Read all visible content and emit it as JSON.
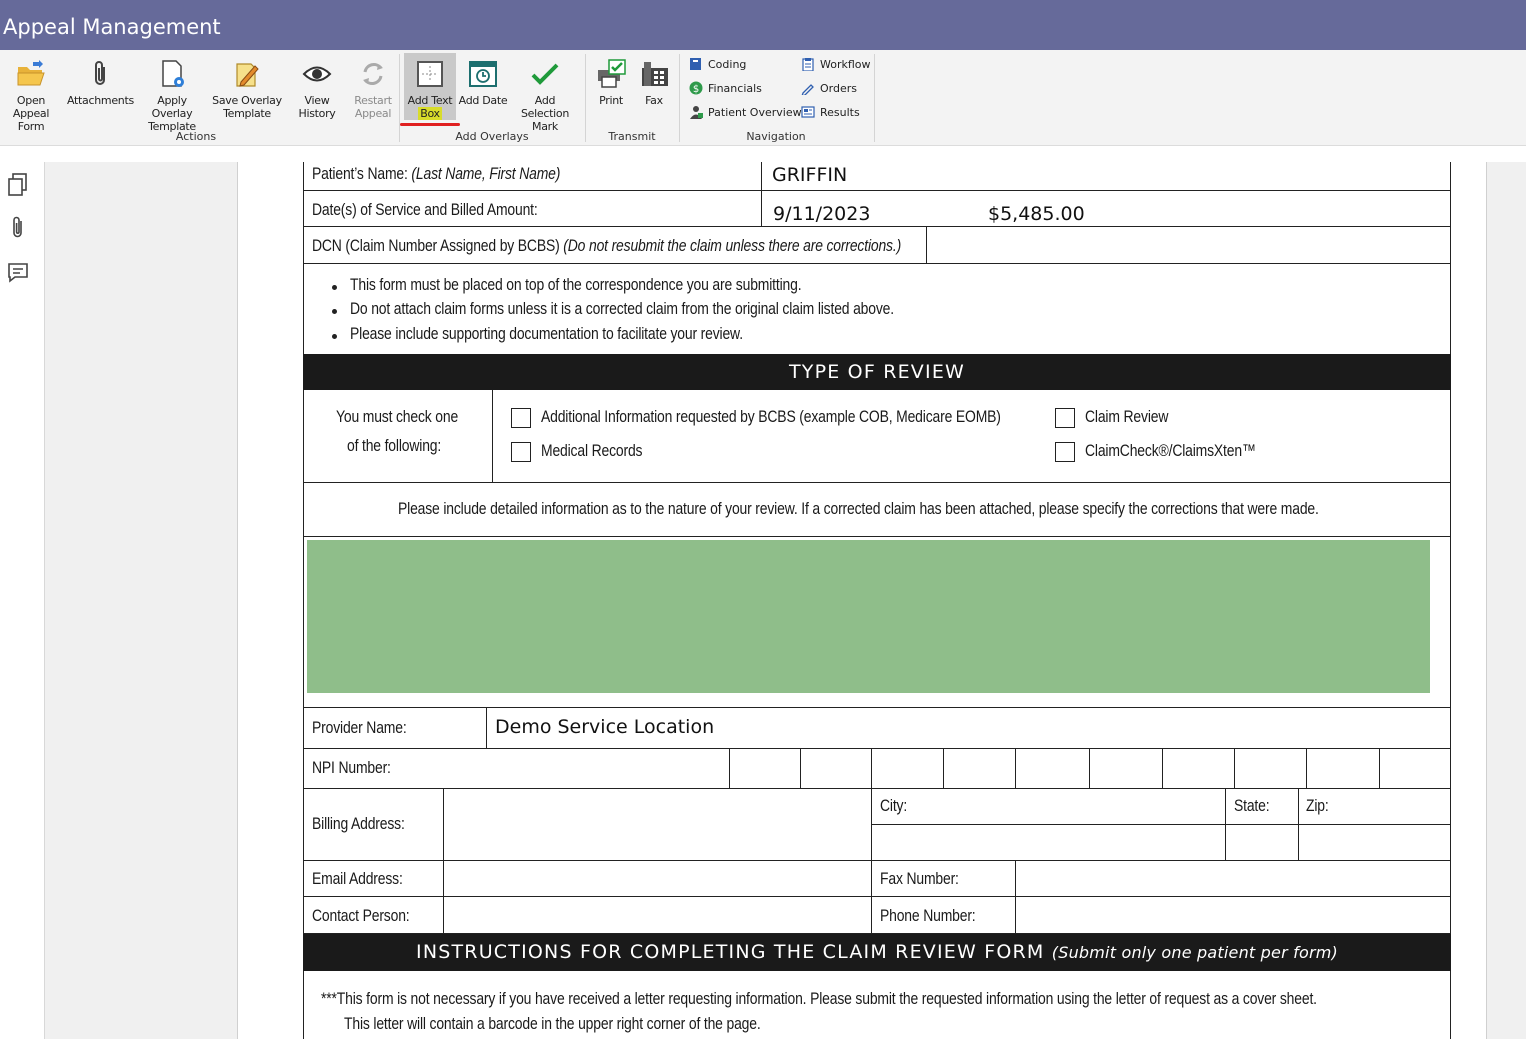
{
  "window": {
    "title": "Appeal Management"
  },
  "ribbon": {
    "actions": {
      "group_label": "Actions",
      "open_appeal_form": "Open Appeal\nForm",
      "attachments": "Attachments",
      "apply_overlay_template": "Apply Overlay\nTemplate",
      "save_overlay_template": "Save Overlay\nTemplate",
      "view_history": "View History",
      "restart_appeal": "Restart\nAppeal"
    },
    "add_overlays": {
      "group_label": "Add Overlays",
      "add_text_box_line1": "Add Text",
      "add_text_box_line2": "Box",
      "add_date": "Add Date",
      "add_selection_mark": "Add Selection\nMark"
    },
    "transmit": {
      "group_label": "Transmit",
      "print": "Print",
      "fax": "Fax"
    },
    "navigation": {
      "group_label": "Navigation",
      "coding": "Coding",
      "financials": "Financials",
      "patient_overview": "Patient Overview",
      "workflow": "Workflow",
      "orders": "Orders",
      "results": "Results"
    }
  },
  "form": {
    "patient_name_label": "Patient’s Name:",
    "patient_name_hint": "(Last Name, First Name)",
    "patient_name_value": "GRIFFIN",
    "dos_label": "Date(s) of Service and Billed Amount:",
    "dos_value": "9/11/2023",
    "billed_amount": "$5,485.00",
    "dcn_label": "DCN (Claim Number Assigned by BCBS)",
    "dcn_hint": "(Do not resubmit the claim unless there are corrections.)",
    "bullets": [
      "This form must be placed on top of the correspondence you are submitting.",
      "Do not attach claim forms unless it is a corrected claim from the original claim listed above.",
      "Please include supporting documentation to facilitate your review."
    ],
    "type_of_review_header": "TYPE OF REVIEW",
    "must_check_line1": "You must check one",
    "must_check_line2": "of the following:",
    "options": {
      "additional_info": "Additional Information requested by BCBS (example COB, Medicare EOMB)",
      "medical_records": "Medical Records",
      "claim_review": "Claim Review",
      "claimcheck": "ClaimCheck®/ClaimsXten™"
    },
    "detail_instructions": "Please include detailed information as to the nature of your review. If a corrected claim has been attached, please specify the corrections that were made.",
    "provider_name_label": "Provider Name:",
    "provider_name_value": "Demo Service Location",
    "npi_label": "NPI Number:",
    "billing_address_label": "Billing Address:",
    "city_label": "City:",
    "state_label": "State:",
    "zip_label": "Zip:",
    "email_label": "Email Address:",
    "fax_number_label": "Fax Number:",
    "contact_person_label": "Contact Person:",
    "phone_number_label": "Phone Number:",
    "instructions_header": "INSTRUCTIONS FOR COMPLETING THE CLAIM REVIEW FORM",
    "instructions_header_note": "(Submit only one patient per form)",
    "note_line1": "***This form is not necessary if you have received a letter requesting information. Please submit the requested information using the letter of request as a cover sheet.",
    "note_line2": "This letter will contain a barcode in the upper right corner of the page."
  },
  "colors": {
    "titlebar": "#666a9a",
    "highlight": "#d8dc2a",
    "underline": "#e02020",
    "overlay_box": "#8fbe8a"
  }
}
